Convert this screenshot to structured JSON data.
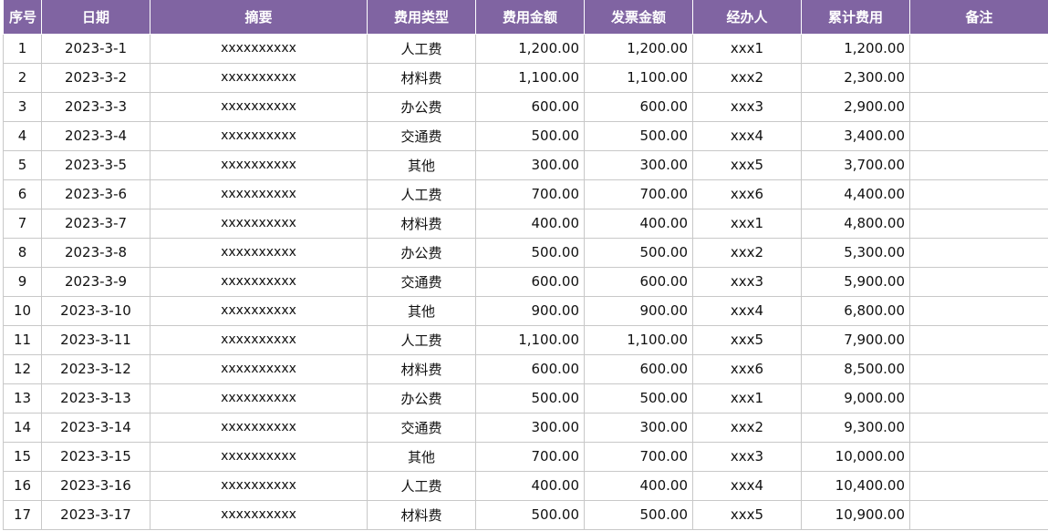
{
  "headers": [
    "序号",
    "日期",
    "摘要",
    "费用类型",
    "费用金额",
    "发票金额",
    "经办人",
    "累计费用",
    "备注"
  ],
  "rows": [
    {
      "no": "1",
      "date": "2023-3-1",
      "summary": "xxxxxxxxxx",
      "type": "人工费",
      "expense": "1,200.00",
      "invoice": "1,200.00",
      "handler": "xxx1",
      "cumulative": "1,200.00",
      "remark": ""
    },
    {
      "no": "2",
      "date": "2023-3-2",
      "summary": "xxxxxxxxxx",
      "type": "材料费",
      "expense": "1,100.00",
      "invoice": "1,100.00",
      "handler": "xxx2",
      "cumulative": "2,300.00",
      "remark": ""
    },
    {
      "no": "3",
      "date": "2023-3-3",
      "summary": "xxxxxxxxxx",
      "type": "办公费",
      "expense": "600.00",
      "invoice": "600.00",
      "handler": "xxx3",
      "cumulative": "2,900.00",
      "remark": ""
    },
    {
      "no": "4",
      "date": "2023-3-4",
      "summary": "xxxxxxxxxx",
      "type": "交通费",
      "expense": "500.00",
      "invoice": "500.00",
      "handler": "xxx4",
      "cumulative": "3,400.00",
      "remark": ""
    },
    {
      "no": "5",
      "date": "2023-3-5",
      "summary": "xxxxxxxxxx",
      "type": "其他",
      "expense": "300.00",
      "invoice": "300.00",
      "handler": "xxx5",
      "cumulative": "3,700.00",
      "remark": ""
    },
    {
      "no": "6",
      "date": "2023-3-6",
      "summary": "xxxxxxxxxx",
      "type": "人工费",
      "expense": "700.00",
      "invoice": "700.00",
      "handler": "xxx6",
      "cumulative": "4,400.00",
      "remark": ""
    },
    {
      "no": "7",
      "date": "2023-3-7",
      "summary": "xxxxxxxxxx",
      "type": "材料费",
      "expense": "400.00",
      "invoice": "400.00",
      "handler": "xxx1",
      "cumulative": "4,800.00",
      "remark": ""
    },
    {
      "no": "8",
      "date": "2023-3-8",
      "summary": "xxxxxxxxxx",
      "type": "办公费",
      "expense": "500.00",
      "invoice": "500.00",
      "handler": "xxx2",
      "cumulative": "5,300.00",
      "remark": ""
    },
    {
      "no": "9",
      "date": "2023-3-9",
      "summary": "xxxxxxxxxx",
      "type": "交通费",
      "expense": "600.00",
      "invoice": "600.00",
      "handler": "xxx3",
      "cumulative": "5,900.00",
      "remark": ""
    },
    {
      "no": "10",
      "date": "2023-3-10",
      "summary": "xxxxxxxxxx",
      "type": "其他",
      "expense": "900.00",
      "invoice": "900.00",
      "handler": "xxx4",
      "cumulative": "6,800.00",
      "remark": ""
    },
    {
      "no": "11",
      "date": "2023-3-11",
      "summary": "xxxxxxxxxx",
      "type": "人工费",
      "expense": "1,100.00",
      "invoice": "1,100.00",
      "handler": "xxx5",
      "cumulative": "7,900.00",
      "remark": ""
    },
    {
      "no": "12",
      "date": "2023-3-12",
      "summary": "xxxxxxxxxx",
      "type": "材料费",
      "expense": "600.00",
      "invoice": "600.00",
      "handler": "xxx6",
      "cumulative": "8,500.00",
      "remark": ""
    },
    {
      "no": "13",
      "date": "2023-3-13",
      "summary": "xxxxxxxxxx",
      "type": "办公费",
      "expense": "500.00",
      "invoice": "500.00",
      "handler": "xxx1",
      "cumulative": "9,000.00",
      "remark": ""
    },
    {
      "no": "14",
      "date": "2023-3-14",
      "summary": "xxxxxxxxxx",
      "type": "交通费",
      "expense": "300.00",
      "invoice": "300.00",
      "handler": "xxx2",
      "cumulative": "9,300.00",
      "remark": ""
    },
    {
      "no": "15",
      "date": "2023-3-15",
      "summary": "xxxxxxxxxx",
      "type": "其他",
      "expense": "700.00",
      "invoice": "700.00",
      "handler": "xxx3",
      "cumulative": "10,000.00",
      "remark": ""
    },
    {
      "no": "16",
      "date": "2023-3-16",
      "summary": "xxxxxxxxxx",
      "type": "人工费",
      "expense": "400.00",
      "invoice": "400.00",
      "handler": "xxx4",
      "cumulative": "10,400.00",
      "remark": ""
    },
    {
      "no": "17",
      "date": "2023-3-17",
      "summary": "xxxxxxxxxx",
      "type": "材料费",
      "expense": "500.00",
      "invoice": "500.00",
      "handler": "xxx5",
      "cumulative": "10,900.00",
      "remark": ""
    }
  ],
  "colors": {
    "header_bg": "#8064a2",
    "header_text": "#ffffff",
    "grid": "#c8c8c8"
  }
}
